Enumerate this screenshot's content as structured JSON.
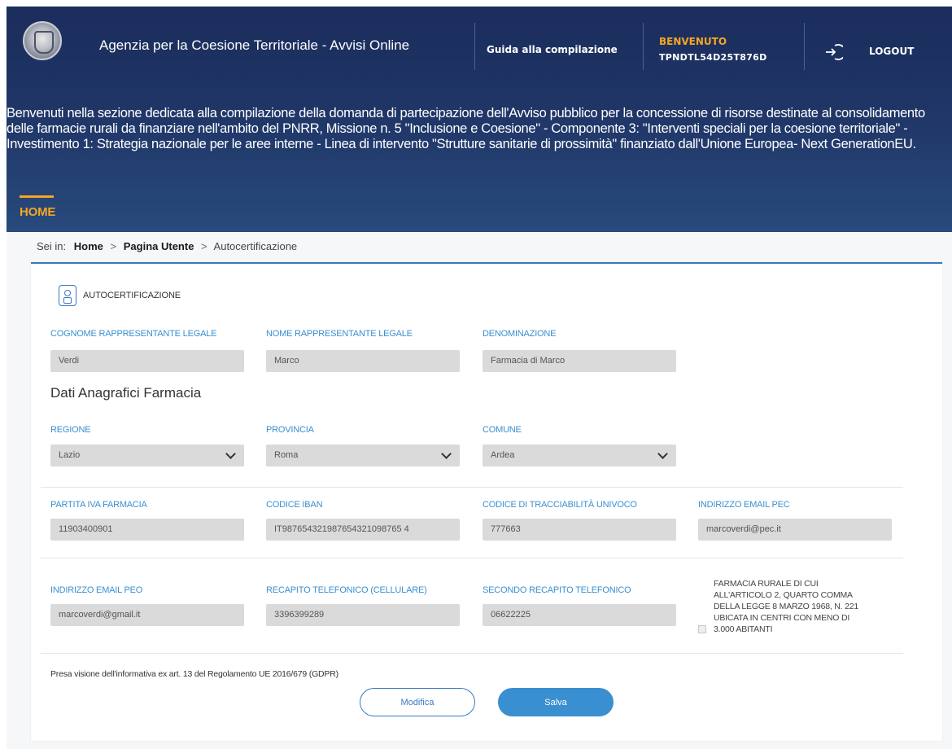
{
  "header": {
    "app_title": "Agenzia per la Coesione Territoriale - Avvisi Online",
    "guide_link": "Guida alla compilazione",
    "welcome_label": "BENVENUTO",
    "user_code": "TPNDTL54D25T876D",
    "logout_label": "LOGOUT",
    "intro_text": "Benvenuti nella sezione dedicata alla compilazione della domanda di partecipazione dell'Avviso pubblico per la concessione di risorse destinate al consolidamento delle farmacie rurali da finanziare nell'ambito del PNRR, Missione n. 5 \"Inclusione e Coesione\" - Componente 3: \"Interventi speciali per la coesione territoriale\" - Investimento 1: Strategia nazionale per le aree interne - Linea di intervento \"Strutture sanitarie di prossimità\" finanziato dall'Unione Europea- Next GenerationEU.",
    "nav_home": "HOME",
    "accent_color": "#f5a623"
  },
  "breadcrumb": {
    "prefix": "Sei in:",
    "items": [
      "Home",
      "Pagina Utente",
      "Autocertificazione"
    ],
    "separator": ">"
  },
  "form": {
    "section_title": "AUTOCERTIFICAZIONE",
    "subtitle": "Dati Anagrafici Farmacia",
    "fields": {
      "cognome": {
        "label": "COGNOME RAPPRESENTANTE LEGALE",
        "value": "Verdi"
      },
      "nome": {
        "label": "NOME RAPPRESENTANTE LEGALE",
        "value": "Marco"
      },
      "denominazione": {
        "label": "DENOMINAZIONE",
        "value": "Farmacia di Marco"
      },
      "regione": {
        "label": "REGIONE",
        "value": "Lazio"
      },
      "provincia": {
        "label": "PROVINCIA",
        "value": "Roma"
      },
      "comune": {
        "label": "COMUNE",
        "value": "Ardea"
      },
      "partita_iva": {
        "label": "PARTITA IVA FARMACIA",
        "value": "11903400901"
      },
      "iban": {
        "label": "CODICE IBAN",
        "value": "IT987654321987654321098765 4"
      },
      "codice_tracciabilita": {
        "label": "CODICE DI TRACCIABILITÀ UNIVOCO",
        "value": "777663"
      },
      "email_pec": {
        "label": "INDIRIZZO EMAIL PEC",
        "value": "marcoverdi@pec.it"
      },
      "email_peo": {
        "label": "INDIRIZZO EMAIL PEO",
        "value": "marcoverdi@gmail.it"
      },
      "cellulare": {
        "label": "RECAPITO TELEFONICO (CELLULARE)",
        "value": "3396399289"
      },
      "secondo_tel": {
        "label": "SECONDO RECAPITO TELEFONICO",
        "value": "06622225"
      }
    },
    "checkbox_text": "FARMACIA RURALE DI CUI ALL'ARTICOLO 2, QUARTO COMMA DELLA LEGGE 8 MARZO 1968, N. 221 UBICATA IN CENTRI CON MENO DI 3.000 ABITANTI",
    "checkbox_checked": false,
    "gdpr_text": "Presa visione dell'informativa ex art. 13 del Regolamento UE 2016/679 (GDPR)",
    "buttons": {
      "modify": "Modifica",
      "save": "Salva"
    },
    "label_color": "#3a8fd0"
  }
}
